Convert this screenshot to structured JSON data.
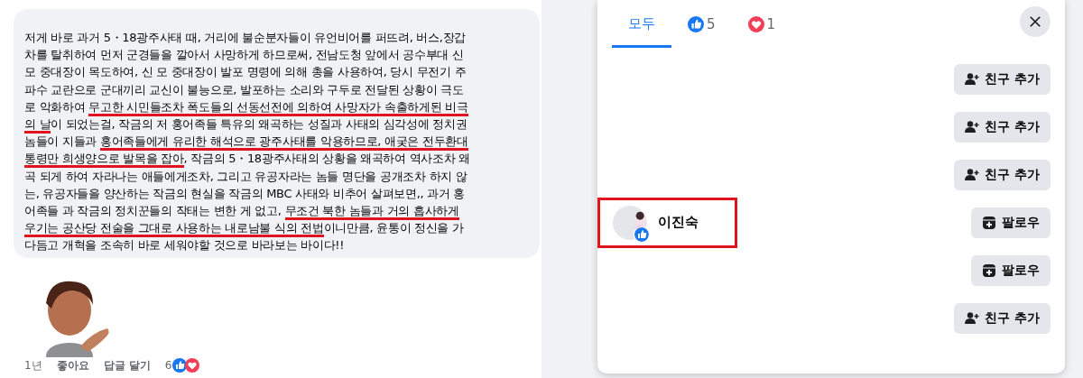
{
  "comment": {
    "lines": [
      [
        {
          "text": "저게 바로 과거 5・18광주사태 때, 거리에 불순분자들이 유언비어를 퍼뜨려, 버스,장갑",
          "underlined": false
        }
      ],
      [
        {
          "text": "차를 탈취하여 먼저 군경들을 깔아서 사망하게 하므로써, 전남도청 앞에서 공수부대 신",
          "underlined": false
        }
      ],
      [
        {
          "text": "모 중대장이 목도하여, 신 모 중대장이 발포 명령에 의해 총을 사용하여, 당시 무전기 주",
          "underlined": false
        }
      ],
      [
        {
          "text": "파수 교란으로 군대끼리 교신이 불능으로, 발포하는 소리와 구두로 전달된 상황이 극도",
          "underlined": false
        }
      ],
      [
        {
          "text": "로 악화하여 ",
          "underlined": false
        },
        {
          "text": "무고한 시민들조차 폭도들의 선동선전에 의하여 사망자가 속출하게된 비극",
          "underlined": true
        }
      ],
      [
        {
          "text": "의 날",
          "underlined": true
        },
        {
          "text": "이 되었는걸, 작금의 저 홍어족들 특유의 왜곡하는 성질과 사태의 심각성에 정치권",
          "underlined": false
        }
      ],
      [
        {
          "text": "놈들이 지들과 ",
          "underlined": false
        },
        {
          "text": "홍어족들에게 유리한 해석으로 광주사태를 악용하므로, 애궂은 전두환대",
          "underlined": true
        }
      ],
      [
        {
          "text": "통령만 희생양으로 발목을 잡아",
          "underlined": true
        },
        {
          "text": ", 작금의 5・18광주사태의 상황을 왜곡하여 역사조차 왜",
          "underlined": false
        }
      ],
      [
        {
          "text": "곡 되게 하여 자라나는 애들에게조차, 그리고 유공자라는 놈들 명단을 공개조차 하지 않",
          "underlined": false
        }
      ],
      [
        {
          "text": "는, 유공자들을 양산하는 작금의 현실을 작금의 MBC 사태와 비추어 살펴보면,, 과거 홍",
          "underlined": false
        }
      ],
      [
        {
          "text": "어족들 과 작금의 정치꾼들의 작태는 변한 게 없고, ",
          "underlined": false
        },
        {
          "text": "무조건 북한 놈들과 거의 흡사하게",
          "underlined": true
        }
      ],
      [
        {
          "text": "우기는 공산당 전술을 그대로 사용하는 내로남불 식의 전법",
          "underlined": true
        },
        {
          "text": "이니만큼, 윤통이 정신을 가",
          "underlined": false
        }
      ],
      [
        {
          "text": "다듬고 개혁을 조속히 바로 세워야할 것으로 바라보는 바이다!!",
          "underlined": false
        }
      ]
    ],
    "sticker": {
      "kind": "picture"
    },
    "footer": {
      "time": "1년",
      "like": "좋아요",
      "reply": "답글 달기",
      "reaction_count": "6"
    }
  },
  "reactions_dialog": {
    "tabs": [
      {
        "kind": "all",
        "label": "모두",
        "selected": true
      },
      {
        "kind": "like",
        "label": "5",
        "selected": false
      },
      {
        "kind": "love",
        "label": "1",
        "selected": false
      }
    ],
    "rows": [
      {
        "button": {
          "kind": "add_friend",
          "label": "친구 추가"
        }
      },
      {
        "button": {
          "kind": "add_friend",
          "label": "친구 추가"
        }
      },
      {
        "button": {
          "kind": "add_friend",
          "label": "친구 추가"
        }
      },
      {
        "name": "이진숙",
        "highlighted": true,
        "button": {
          "kind": "follow",
          "label": "팔로우"
        }
      },
      {
        "button": {
          "kind": "follow",
          "label": "팔로우"
        }
      },
      {
        "button": {
          "kind": "add_friend",
          "label": "친구 추가"
        }
      }
    ]
  }
}
